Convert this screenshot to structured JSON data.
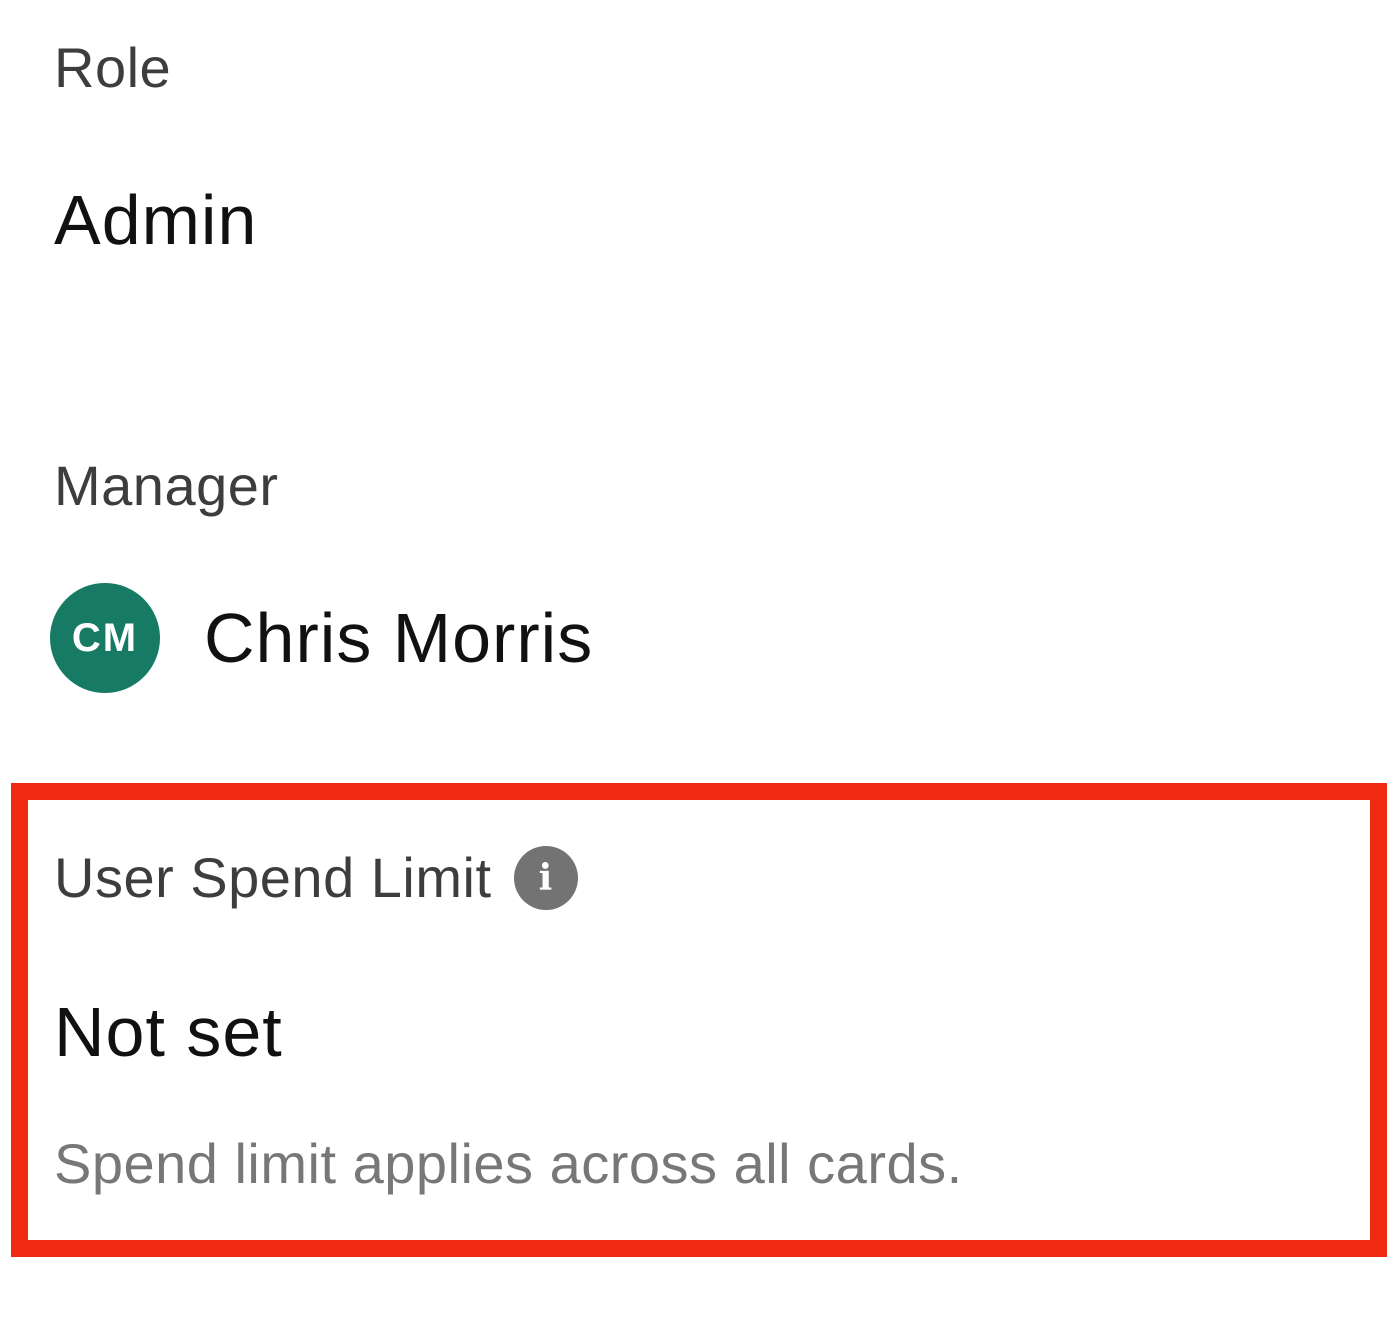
{
  "role": {
    "label": "Role",
    "value": "Admin"
  },
  "manager": {
    "label": "Manager",
    "avatar_initials": "CM",
    "avatar_color": "#177a64",
    "name": "Chris Morris"
  },
  "spend_limit": {
    "label": "User Spend Limit",
    "info_icon": "info-icon",
    "info_icon_color": "#737373",
    "value": "Not set",
    "hint": "Spend limit applies across all cards.",
    "highlight_color": "#f02a10"
  }
}
